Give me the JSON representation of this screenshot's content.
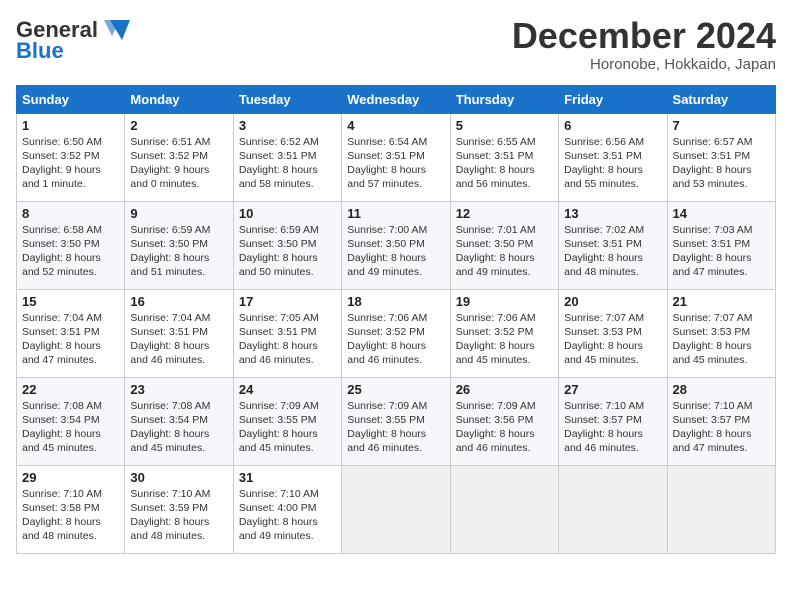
{
  "header": {
    "logo_general": "General",
    "logo_blue": "Blue",
    "month_title": "December 2024",
    "location": "Horonobe, Hokkaido, Japan"
  },
  "days_of_week": [
    "Sunday",
    "Monday",
    "Tuesday",
    "Wednesday",
    "Thursday",
    "Friday",
    "Saturday"
  ],
  "weeks": [
    [
      {
        "day": "1",
        "info": "Sunrise: 6:50 AM\nSunset: 3:52 PM\nDaylight: 9 hours\nand 1 minute."
      },
      {
        "day": "2",
        "info": "Sunrise: 6:51 AM\nSunset: 3:52 PM\nDaylight: 9 hours\nand 0 minutes."
      },
      {
        "day": "3",
        "info": "Sunrise: 6:52 AM\nSunset: 3:51 PM\nDaylight: 8 hours\nand 58 minutes."
      },
      {
        "day": "4",
        "info": "Sunrise: 6:54 AM\nSunset: 3:51 PM\nDaylight: 8 hours\nand 57 minutes."
      },
      {
        "day": "5",
        "info": "Sunrise: 6:55 AM\nSunset: 3:51 PM\nDaylight: 8 hours\nand 56 minutes."
      },
      {
        "day": "6",
        "info": "Sunrise: 6:56 AM\nSunset: 3:51 PM\nDaylight: 8 hours\nand 55 minutes."
      },
      {
        "day": "7",
        "info": "Sunrise: 6:57 AM\nSunset: 3:51 PM\nDaylight: 8 hours\nand 53 minutes."
      }
    ],
    [
      {
        "day": "8",
        "info": "Sunrise: 6:58 AM\nSunset: 3:50 PM\nDaylight: 8 hours\nand 52 minutes."
      },
      {
        "day": "9",
        "info": "Sunrise: 6:59 AM\nSunset: 3:50 PM\nDaylight: 8 hours\nand 51 minutes."
      },
      {
        "day": "10",
        "info": "Sunrise: 6:59 AM\nSunset: 3:50 PM\nDaylight: 8 hours\nand 50 minutes."
      },
      {
        "day": "11",
        "info": "Sunrise: 7:00 AM\nSunset: 3:50 PM\nDaylight: 8 hours\nand 49 minutes."
      },
      {
        "day": "12",
        "info": "Sunrise: 7:01 AM\nSunset: 3:50 PM\nDaylight: 8 hours\nand 49 minutes."
      },
      {
        "day": "13",
        "info": "Sunrise: 7:02 AM\nSunset: 3:51 PM\nDaylight: 8 hours\nand 48 minutes."
      },
      {
        "day": "14",
        "info": "Sunrise: 7:03 AM\nSunset: 3:51 PM\nDaylight: 8 hours\nand 47 minutes."
      }
    ],
    [
      {
        "day": "15",
        "info": "Sunrise: 7:04 AM\nSunset: 3:51 PM\nDaylight: 8 hours\nand 47 minutes."
      },
      {
        "day": "16",
        "info": "Sunrise: 7:04 AM\nSunset: 3:51 PM\nDaylight: 8 hours\nand 46 minutes."
      },
      {
        "day": "17",
        "info": "Sunrise: 7:05 AM\nSunset: 3:51 PM\nDaylight: 8 hours\nand 46 minutes."
      },
      {
        "day": "18",
        "info": "Sunrise: 7:06 AM\nSunset: 3:52 PM\nDaylight: 8 hours\nand 46 minutes."
      },
      {
        "day": "19",
        "info": "Sunrise: 7:06 AM\nSunset: 3:52 PM\nDaylight: 8 hours\nand 45 minutes."
      },
      {
        "day": "20",
        "info": "Sunrise: 7:07 AM\nSunset: 3:53 PM\nDaylight: 8 hours\nand 45 minutes."
      },
      {
        "day": "21",
        "info": "Sunrise: 7:07 AM\nSunset: 3:53 PM\nDaylight: 8 hours\nand 45 minutes."
      }
    ],
    [
      {
        "day": "22",
        "info": "Sunrise: 7:08 AM\nSunset: 3:54 PM\nDaylight: 8 hours\nand 45 minutes."
      },
      {
        "day": "23",
        "info": "Sunrise: 7:08 AM\nSunset: 3:54 PM\nDaylight: 8 hours\nand 45 minutes."
      },
      {
        "day": "24",
        "info": "Sunrise: 7:09 AM\nSunset: 3:55 PM\nDaylight: 8 hours\nand 45 minutes."
      },
      {
        "day": "25",
        "info": "Sunrise: 7:09 AM\nSunset: 3:55 PM\nDaylight: 8 hours\nand 46 minutes."
      },
      {
        "day": "26",
        "info": "Sunrise: 7:09 AM\nSunset: 3:56 PM\nDaylight: 8 hours\nand 46 minutes."
      },
      {
        "day": "27",
        "info": "Sunrise: 7:10 AM\nSunset: 3:57 PM\nDaylight: 8 hours\nand 46 minutes."
      },
      {
        "day": "28",
        "info": "Sunrise: 7:10 AM\nSunset: 3:57 PM\nDaylight: 8 hours\nand 47 minutes."
      }
    ],
    [
      {
        "day": "29",
        "info": "Sunrise: 7:10 AM\nSunset: 3:58 PM\nDaylight: 8 hours\nand 48 minutes."
      },
      {
        "day": "30",
        "info": "Sunrise: 7:10 AM\nSunset: 3:59 PM\nDaylight: 8 hours\nand 48 minutes."
      },
      {
        "day": "31",
        "info": "Sunrise: 7:10 AM\nSunset: 4:00 PM\nDaylight: 8 hours\nand 49 minutes."
      },
      null,
      null,
      null,
      null
    ]
  ]
}
